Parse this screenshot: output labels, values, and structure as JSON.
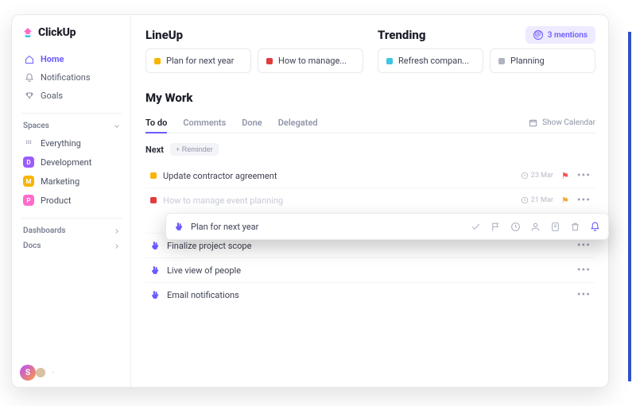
{
  "app_name": "ClickUp",
  "sidebar": {
    "nav": [
      {
        "label": "Home",
        "icon": "home-icon",
        "active": true
      },
      {
        "label": "Notifications",
        "icon": "bell-icon",
        "active": false
      },
      {
        "label": "Goals",
        "icon": "trophy-icon",
        "active": false
      }
    ],
    "spaces_header": "Spaces",
    "spaces": [
      {
        "label": "Everything",
        "badge": null,
        "color": null,
        "icon": "grid-icon"
      },
      {
        "label": "Development",
        "badge": "D",
        "color": "#9b5bff"
      },
      {
        "label": "Marketing",
        "badge": "M",
        "color": "#f7b500"
      },
      {
        "label": "Product",
        "badge": "P",
        "color": "#ff6bcb"
      }
    ],
    "dashboards_label": "Dashboards",
    "docs_label": "Docs"
  },
  "main": {
    "lineup_heading": "LineUp",
    "trending_heading": "Trending",
    "mentions_label": "3 mentions",
    "lineup_cards": [
      {
        "label": "Plan for next year",
        "color": "#f7b500"
      },
      {
        "label": "How to manage...",
        "color": "#e23c3c"
      }
    ],
    "trending_cards": [
      {
        "label": "Refresh compan...",
        "color": "#3cc7e2"
      },
      {
        "label": "Planning",
        "color": "#aeb2c3"
      }
    ],
    "mywork_heading": "My Work",
    "tabs": [
      {
        "label": "To do",
        "active": true
      },
      {
        "label": "Comments",
        "active": false
      },
      {
        "label": "Done",
        "active": false
      },
      {
        "label": "Delegated",
        "active": false
      }
    ],
    "show_calendar_label": "Show Calendar",
    "next_label": "Next",
    "reminder_label": "+ Reminder",
    "tasks": [
      {
        "type": "color",
        "color": "#f7b500",
        "label": "Update contractor agreement",
        "date": "23 Mar",
        "flag": "red",
        "show_dots": true
      },
      {
        "type": "color",
        "color": "#e23c3c",
        "label": "How to manage event planning",
        "date": "21 Mar",
        "flag": "orange",
        "show_dots": true
      },
      {
        "type": "hand",
        "label": "Finalize project scope",
        "date": null,
        "flag": null,
        "show_dots": true
      },
      {
        "type": "hand",
        "label": "Live view of people",
        "date": null,
        "flag": null,
        "show_dots": true
      },
      {
        "type": "hand",
        "label": "Email notifications",
        "date": null,
        "flag": null,
        "show_dots": true
      }
    ],
    "float_task_label": "Plan for next year"
  }
}
